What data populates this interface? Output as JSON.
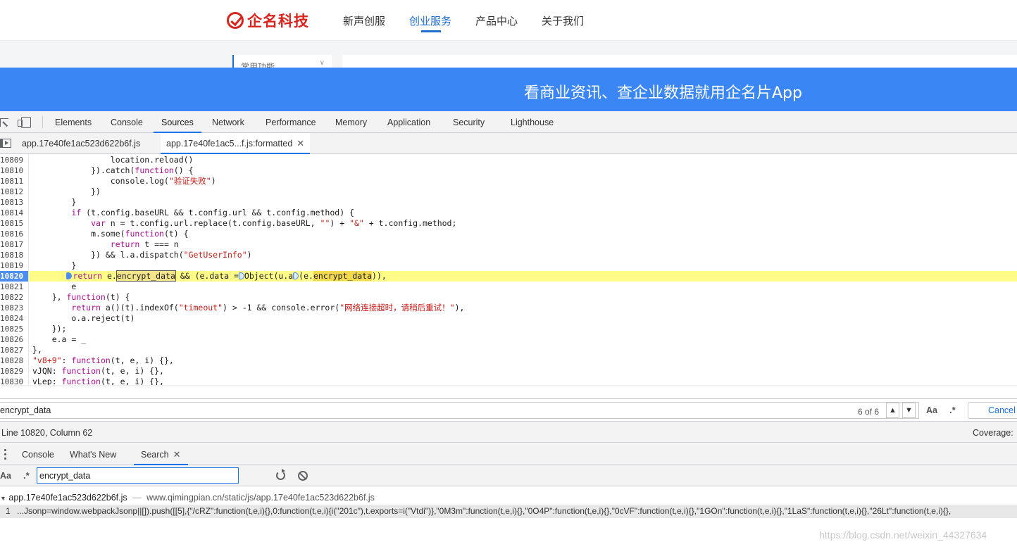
{
  "site": {
    "logo_text": "企名科技",
    "nav": [
      "新声创服",
      "创业服务",
      "产品中心",
      "关于我们"
    ],
    "active_nav": "创业服务",
    "side_menu_label": "常用功能",
    "banner_text": "看商业资讯、查企业数据就用企名片App"
  },
  "devtools": {
    "tabs": [
      "Elements",
      "Console",
      "Sources",
      "Network",
      "Performance",
      "Memory",
      "Application",
      "Security",
      "Lighthouse"
    ],
    "active_tab": "Sources",
    "file_tabs": [
      "app.17e40fe1ac523d622b6f.js",
      "app.17e40fe1ac5...f.js:formatted"
    ],
    "active_file": "app.17e40fe1ac5...f.js:formatted",
    "code_lines": [
      {
        "no": "10809",
        "text": "                location.reload()"
      },
      {
        "no": "10810",
        "text": "            }).catch(function() {"
      },
      {
        "no": "10811",
        "text": "                console.log(\"验证失败\")"
      },
      {
        "no": "10812",
        "text": "            })"
      },
      {
        "no": "10813",
        "text": "        }"
      },
      {
        "no": "10814",
        "text": "        if (t.config.baseURL && t.config.url && t.config.method) {"
      },
      {
        "no": "10815",
        "text": "            var n = t.config.url.replace(t.config.baseURL, \"\") + \"&\" + t.config.method;"
      },
      {
        "no": "10816",
        "text": "            m.some(function(t) {"
      },
      {
        "no": "10817",
        "text": "                return t === n"
      },
      {
        "no": "10818",
        "text": "            }) && l.a.dispatch(\"GetUserInfo\")"
      },
      {
        "no": "10819",
        "text": "        }"
      },
      {
        "no": "10820",
        "text": "        return e.encrypt_data && (e.data = Object(u.a)(e.encrypt_data)),"
      },
      {
        "no": "10821",
        "text": "        e"
      },
      {
        "no": "10822",
        "text": "    }, function(t) {"
      },
      {
        "no": "10823",
        "text": "        return a()(t).indexOf(\"timeout\") > -1 && console.error(\"网络连接超时，请稍后重试！\"),"
      },
      {
        "no": "10824",
        "text": "        o.a.reject(t)"
      },
      {
        "no": "10825",
        "text": "    });"
      },
      {
        "no": "10826",
        "text": "    e.a = _"
      },
      {
        "no": "10827",
        "text": "},"
      },
      {
        "no": "10828",
        "text": "\"v8+9\": function(t, e, i) {},"
      },
      {
        "no": "10829",
        "text": "vJQN: function(t, e, i) {},"
      },
      {
        "no": "10830",
        "text": "vLep: function(t, e, i) {},"
      },
      {
        "no": "10831",
        "text": ""
      }
    ],
    "exec_line": "10820",
    "find": {
      "query": "encrypt_data",
      "count": "6 of 6",
      "case_label": "Aa",
      "regex_label": ".*",
      "cancel_label": "Cancel"
    },
    "status": {
      "cursor": "Line 10820, Column 62",
      "coverage": "Coverage:"
    },
    "drawer": {
      "tabs": [
        "Console",
        "What's New",
        "Search"
      ],
      "active_tab": "Search",
      "search_query": "encrypt_data",
      "case_label": "Aa",
      "regex_label": ".*",
      "result_file": "app.17e40fe1ac523d622b6f.js",
      "result_sep": "—",
      "result_path": "www.qimingpian.cn/static/js/app.17e40fe1ac523d622b6f.js",
      "result_line": "1",
      "result_snippet": "...Jsonp=window.webpackJsonp||[]).push([[5],{\"/cRZ\":function(t,e,i){},0:function(t,e,i){i(\"201c\"),t.exports=i(\"Vtdi\")},\"0M3m\":function(t,e,i){},\"0O4P\":function(t,e,i){},\"0cVF\":function(t,e,i){},\"1GOn\":function(t,e,i){},\"1LaS\":function(t,e,i){},\"26Lt\":function(t,e,i){},"
    }
  },
  "watermark": "https://blog.csdn.net/weixin_44327634",
  "colors": {
    "brand_red": "#d9231d",
    "banner_blue": "#3a86f5",
    "devtools_accent": "#1a73e8",
    "exec_highlight": "#fffd88"
  }
}
